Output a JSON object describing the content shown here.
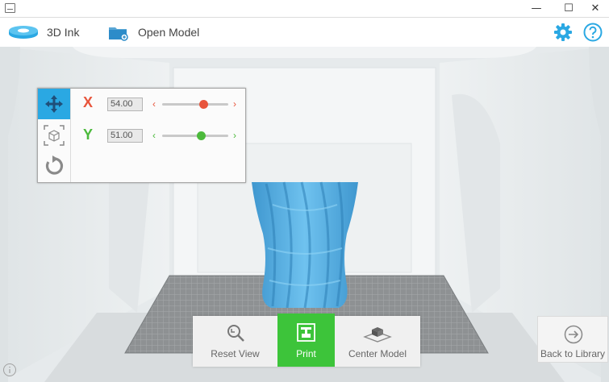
{
  "window": {
    "minimize_glyph": "—",
    "maximize_glyph": "☐",
    "close_glyph": "✕"
  },
  "toolbar": {
    "ink_label": "3D Ink",
    "open_model_label": "Open Model",
    "ink_icon": "filament-spool-icon",
    "open_model_icon": "folder-icon",
    "settings_icon": "gear-icon",
    "help_icon": "help-icon"
  },
  "move_panel": {
    "tools": [
      {
        "name": "move",
        "active": true
      },
      {
        "name": "scale",
        "active": false
      },
      {
        "name": "rotate",
        "active": false
      }
    ],
    "x": {
      "label": "X",
      "value": "54.00",
      "slider_fraction": 0.54,
      "color": "#e8553c"
    },
    "y": {
      "label": "Y",
      "value": "51.00",
      "slider_fraction": 0.51,
      "color": "#4cba3c"
    },
    "chevron_left": "‹",
    "chevron_right": "›"
  },
  "actions": {
    "reset_view": "Reset View",
    "print": "Print",
    "center_model": "Center Model",
    "back_to_library": "Back to Library"
  },
  "colors": {
    "accent_blue": "#2aa8e3",
    "print_green": "#3dc43a",
    "model_blue": "#4aa9e0"
  }
}
